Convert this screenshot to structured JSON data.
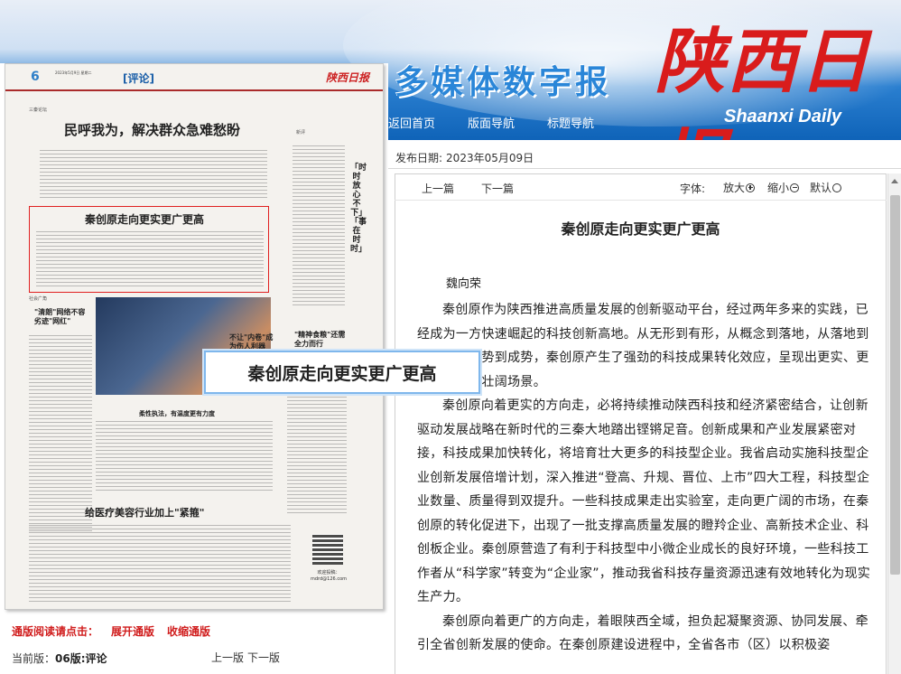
{
  "header": {
    "title": "多媒体数字报",
    "logo_cn": "陕西日报",
    "logo_en": "Shaanxi Daily",
    "nav": [
      "返回首页",
      "版面导航",
      "标题导航"
    ]
  },
  "newspaper": {
    "page_num": "6",
    "section": "[评论]",
    "mini_logo": "陕西日报",
    "col_label_left": "三秦论坛",
    "col_label_right": "新评",
    "col_label_social": "社会广角",
    "head1": "民呼我为，解决群众急难愁盼",
    "head2": "秦创原走向更实更广更高",
    "head3": "柔性执法，有温度更有力度",
    "head4": "给医疗美容行业加上\"紧箍\"",
    "vertical": "「时时放心不下」「事在时时」",
    "side_head_left": "\"清朗\"网络不容劣迹\"网红\"",
    "side_head_mid": "不让\"内卷\"成为伤人利器",
    "side_head_right": "\"精神食粮\"还需全力而行",
    "qr_caption": "欢迎投稿：mdrd@126.com",
    "popup_title": "秦创原走向更实更广更高"
  },
  "reading": {
    "label": "通版阅读请点击：",
    "expand": "展开通版",
    "collapse": "收缩通版",
    "current_label": "当前版：",
    "current_value": "06版:评论",
    "prev_page": "上一版",
    "next_page": "下一版"
  },
  "article": {
    "pubdate_label": "发布日期:",
    "pubdate": "2023年05月09日",
    "prev": "上一篇",
    "next": "下一篇",
    "font_label": "字体:",
    "font_larger": "放大",
    "font_smaller": "缩小",
    "font_default": "默认",
    "title": "秦创原走向更实更广更高",
    "author": "魏向荣",
    "paragraphs": [
      "秦创原作为陕西推进高质量发展的创新驱动平台，经过两年多来的实践，已经成为一方快速崛起的科技创新高地。从无形到有形，从概念到落地，从落地到抬升，从起势到成势，秦创原产生了强劲的科技成果转化效应，呈现出更实、更广、更高的壮阔场景。",
      "秦创原向着更实的方向走，必将持续推动陕西科技和经济紧密结合，让创新驱动发展战略在新时代的三秦大地踏出铿锵足音。创新成果和产业发展紧密对接，科技成果加快转化，将培育壮大更多的科技型企业。我省启动实施科技型企业创新发展倍增计划，深入推进“登高、升规、晋位、上市”四大工程，科技型企业数量、质量得到双提升。一些科技成果走出实验室，走向更广阔的市场，在秦创原的转化促进下，出现了一批支撑高质量发展的瞪羚企业、高新技术企业、科创板企业。秦创原营造了有利于科技型中小微企业成长的良好环境，一些科技工作者从“科学家”转变为“企业家”，推动我省科技存量资源迅速有效地转化为现实生产力。",
      "秦创原向着更广的方向走，着眼陕西全域，担负起凝聚资源、协同发展、牵引全省创新发展的使命。在秦创原建设进程中，全省各市（区）以积极姿"
    ]
  },
  "colors": {
    "brand_blue": "#2a86d8",
    "logo_red": "#d91c1c",
    "nav_bg": "#0f63b8",
    "link_red": "#d01c1c"
  }
}
